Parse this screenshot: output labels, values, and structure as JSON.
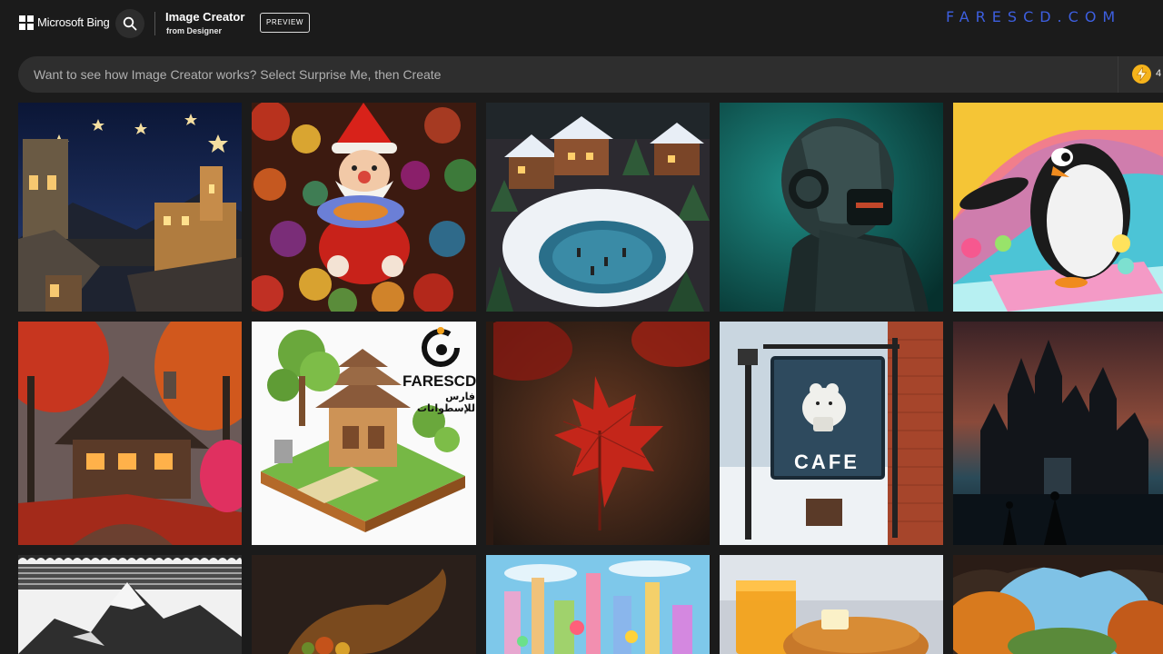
{
  "header": {
    "brand": "Microsoft Bing",
    "title": "Image Creator",
    "subtitle": "from Designer",
    "preview_badge": "PREVIEW",
    "watermark": "FARESCD.COM"
  },
  "prompt": {
    "placeholder": "Want to see how Image Creator works? Select Surprise Me, then Create",
    "boost_count": "4"
  },
  "overlay_logo": {
    "name": "FARESCD",
    "arabic": "فارس للإسطوانات"
  },
  "cafe_sign": "CAFE",
  "icons": [
    "microsoft-logo-icon",
    "search-icon",
    "boost-bolt-icon"
  ],
  "colors": {
    "page_bg": "#1b1b1b",
    "prompt_bg": "#2e2e2e",
    "watermark": "#3d5fe0",
    "boost": "#f5b31b"
  }
}
